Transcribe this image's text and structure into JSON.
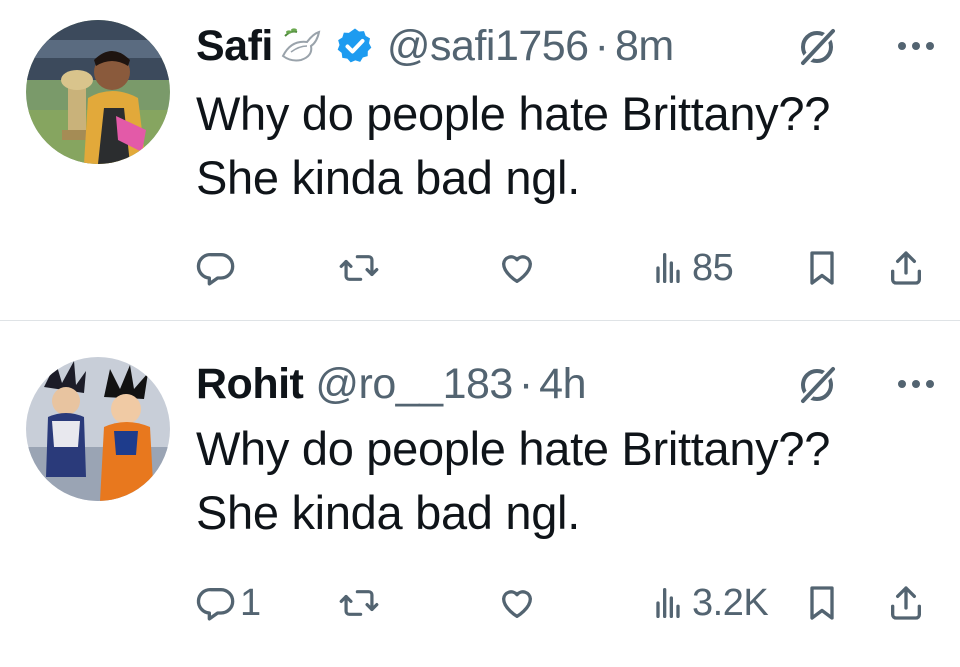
{
  "tweets": [
    {
      "name": "Safi",
      "name_emoji": "dove-emoji",
      "verified": true,
      "handle": "@safi1756",
      "separator": "·",
      "time": "8m",
      "text_lines": [
        "Why do people hate Brittany??",
        "She kinda bad ngl."
      ],
      "reply_count": "",
      "retweet_count": "",
      "like_count": "",
      "views": "85"
    },
    {
      "name": "Rohit",
      "verified": false,
      "handle": "@ro__183",
      "separator": "·",
      "time": "4h",
      "text_lines": [
        "Why do people hate Brittany??",
        "She kinda bad ngl."
      ],
      "reply_count": "1",
      "retweet_count": "",
      "like_count": "",
      "views": "3.2K"
    }
  ],
  "icons": {
    "reply": "reply-icon",
    "retweet": "retweet-icon",
    "like": "like-icon",
    "views": "views-icon",
    "bookmark": "bookmark-icon",
    "share": "share-icon",
    "grok": "grok-icon",
    "more": "more-icon",
    "verified": "verified-badge-icon"
  },
  "colors": {
    "text": "#0f1419",
    "secondary": "#536471",
    "verified_blue": "#1d9bf0",
    "divider": "#dfe3e6"
  }
}
